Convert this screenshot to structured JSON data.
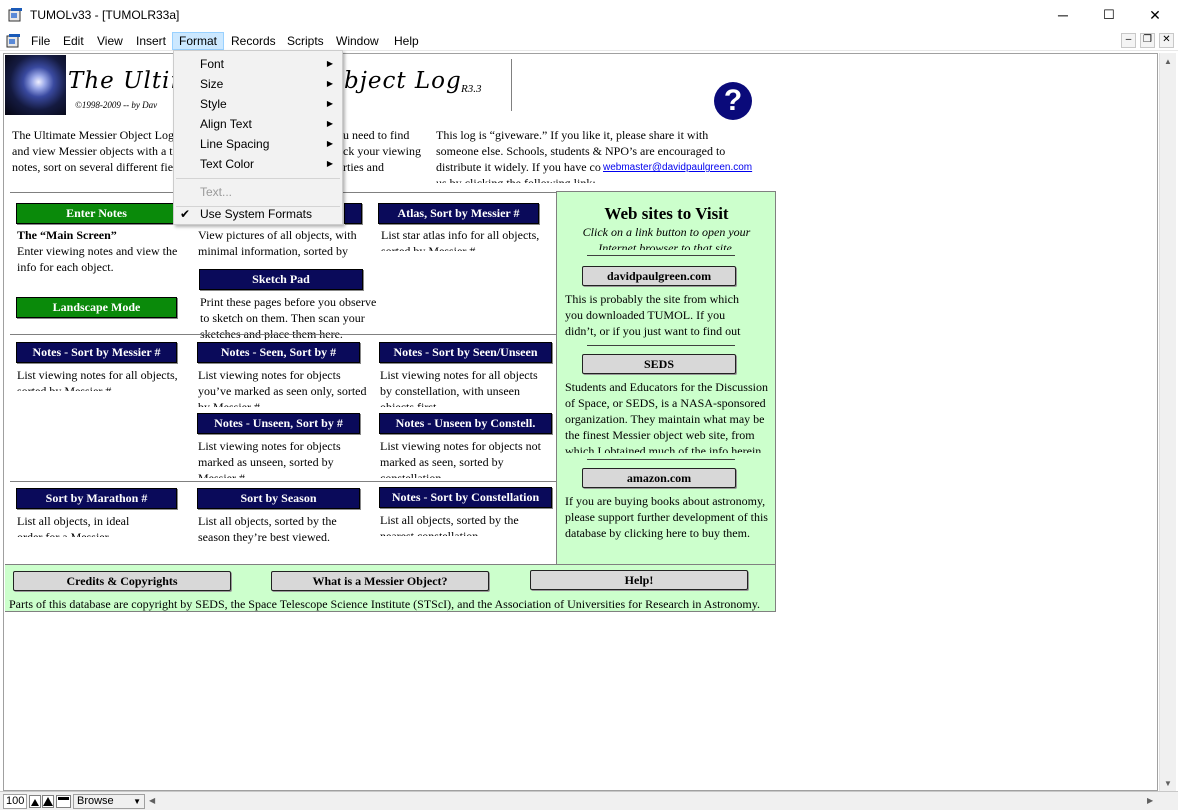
{
  "window": {
    "title": "TUMOLv33 - [TUMOLR33a]",
    "minimize": "─",
    "maximize": "☐",
    "close": "✕"
  },
  "menu": [
    "File",
    "Edit",
    "View",
    "Insert",
    "Format",
    "Records",
    "Scripts",
    "Window",
    "Help"
  ],
  "format_menu": {
    "items": [
      "Font",
      "Size",
      "Style",
      "Align Text",
      "Line Spacing",
      "Text Color"
    ],
    "text_item": "Text...",
    "system_formats": "Use System Formats"
  },
  "header": {
    "title_left": "The Ultim",
    "title_right": "bject Log",
    "version": "R3.3",
    "copyright": "©1998-2009  --  by Dav"
  },
  "intro": {
    "left": "The Ultimate Messier Object Log\nand view Messier objects with a t\nnotes, sort on several different fie",
    "middle": "u need to find\nck your viewing\nrties and",
    "right": "This log is “giveware.” If you like it, please share it with\nsomeone else. Schools, students & NPO’s are encouraged to\ndistribute it widely. If you have co\nus by clicking the following link:",
    "email": "webmaster@davidpaulgreen.com"
  },
  "buttons": {
    "enter_notes": "Enter Notes",
    "atlas": "Atlas, Sort by Messier #",
    "sketch_pad": "Sketch Pad",
    "landscape": "Landscape Mode",
    "notes_messier": "Notes - Sort by Messier #",
    "notes_seen": "Notes - Seen, Sort by #",
    "notes_seen_unseen": "Notes - Sort by Seen/Unseen",
    "notes_unseen": "Notes - Unseen, Sort by #",
    "notes_unseen_constell": "Notes - Unseen by Constell.",
    "sort_marathon": "Sort by Marathon #",
    "sort_season": "Sort by Season",
    "notes_constellation": "Notes - Sort by Constellation"
  },
  "descriptions": {
    "main_screen_title": "The “Main Screen”",
    "main_screen": "Enter viewing notes and view the\ninfo for each object.",
    "pictures": "View pictures of all objects, with\nminimal information, sorted by\nMessier #.",
    "atlas": "List star atlas info for all objects,\nsorted by Messier #.",
    "sketch": "Print these pages before you observe\nto sketch on them. Then scan your\nsketches and place them here.",
    "notes_messier": "List viewing notes for all objects,\nsorted by Messier #.",
    "notes_seen": "List viewing notes for objects\nyou’ve marked as seen only, sorted\nby Messier #.",
    "notes_seen_unseen": "List  viewing notes for all objects\nby constellation, with unseen\nobjects first.",
    "notes_unseen": "List viewing notes for objects\nmarked as unseen, sorted by\nMessier #.",
    "notes_unseen_constell": "List viewing notes for objects not\nmarked as seen, sorted by\nconstellation.",
    "marathon": "List all objects, in ideal\norder  for a Messier\nmarathon.",
    "season": "List all objects, sorted by the\nseason they’re best viewed.",
    "constellation": "List all objects, sorted by the\nnearest  constellation."
  },
  "sites": {
    "title": "Web sites to Visit",
    "subtitle": "Click on a link button to open your\nInternet browser to that site.",
    "dpg_button": "davidpaulgreen.com",
    "dpg_text": "This is probably the site from which\nyou downloaded TUMOL. If you\ndidn’t, or if you just want to find out\nmore about the author...",
    "seds_button": "SEDS",
    "seds_text": "Students and Educators for the Discussion\nof Space, or SEDS, is a NASA-sponsored\norganization. They maintain what may be\nthe finest Messier object web site, from\nwhich I obtained much of the info herein.",
    "amazon_button": "amazon.com",
    "amazon_text": "If you are buying books about astronomy,\nplease support further development of this\ndatabase by clicking here to buy them."
  },
  "footer": {
    "credits": "Credits & Copyrights",
    "what_is": "What is a Messier Object?",
    "help": "Help!",
    "copyright": "Parts of this database are copyright by SEDS, the Space Telescope Science Institute (STScI), and the Association of  Universities for Research in Astronomy."
  },
  "status": {
    "zoom": "100",
    "mode": "Browse"
  },
  "colors": {
    "nav_button": "#0a0a5a",
    "green_button": "#0a8a0a",
    "sites_panel": "#ccffcc",
    "help_icon": "#0a0a7a"
  }
}
